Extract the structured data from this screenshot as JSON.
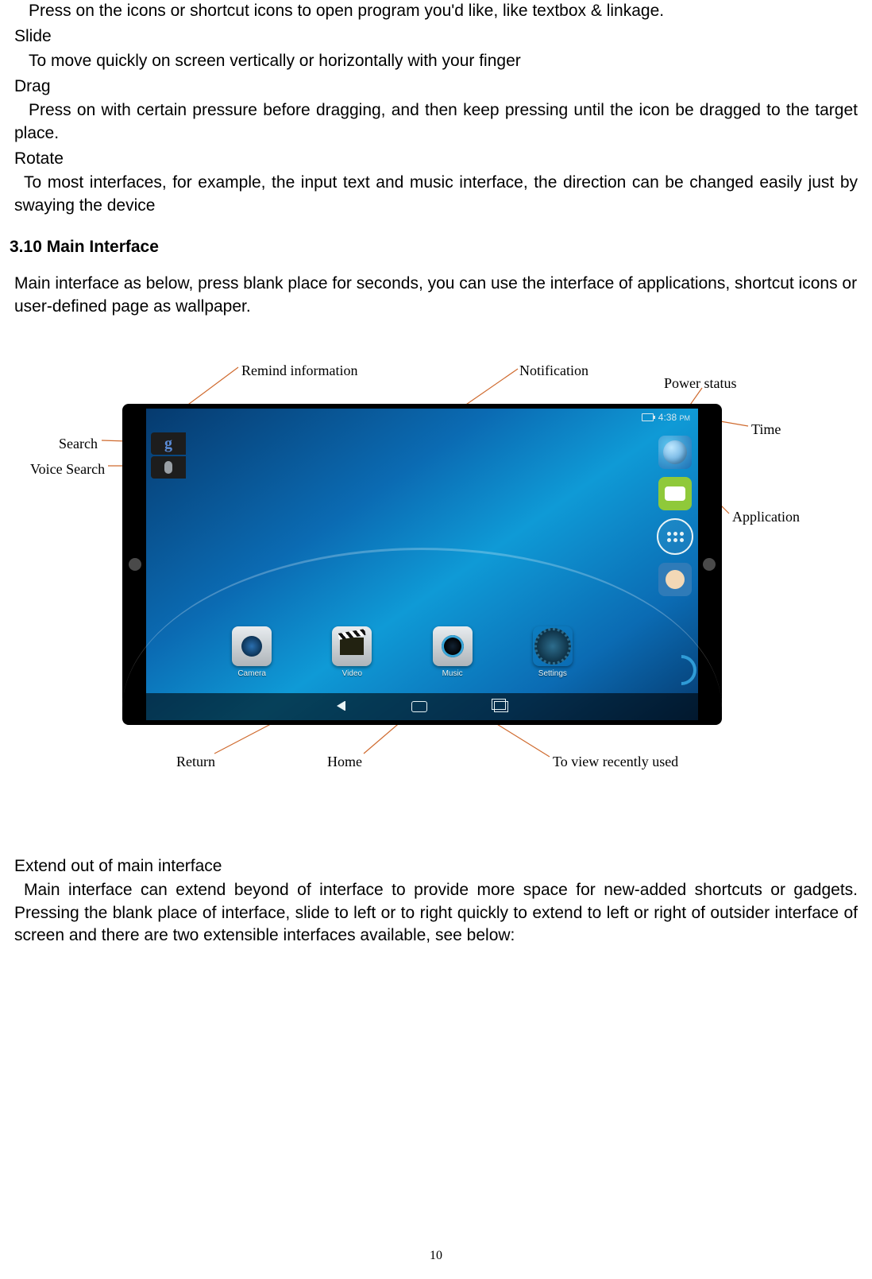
{
  "intro_text": "Press on the icons or shortcut icons to open program you'd like, like textbox & linkage.",
  "slide": {
    "heading": "Slide",
    "body": "To move quickly on screen vertically or horizontally with your finger"
  },
  "drag": {
    "heading": "Drag",
    "body": "Press on with certain pressure before dragging, and then keep pressing until the icon be dragged to the target place."
  },
  "rotate": {
    "heading": "Rotate",
    "body": "To most interfaces, for example, the input text and music interface,  the direction can be changed easily just by swaying the device"
  },
  "section_heading": "3.10 Main Interface",
  "section_body": "Main interface as below, press blank place for seconds, you can use the interface of applications, shortcut icons or user-defined page as wallpaper.",
  "figure": {
    "callouts": {
      "remind_information": "Remind information",
      "notification": "Notification",
      "power_status": "Power status",
      "time": "Time",
      "search": "Search",
      "voice_search": "Voice Search",
      "application": "Application",
      "return": "Return",
      "home": "Home",
      "recently_used": "To view recently used"
    },
    "status_time": "4:38",
    "status_time_suffix": "PM",
    "dock": {
      "camera": "Camera",
      "video": "Video",
      "music": "Music",
      "settings": "Settings"
    },
    "search_letter": "g"
  },
  "extend": {
    "heading": "Extend out of main interface",
    "body": "Main interface can extend beyond of interface to provide more space for new-added shortcuts or gadgets. Pressing the blank place of interface, slide to left or to right quickly to extend to left or right of outsider interface of screen and there are two extensible interfaces available, see below:"
  },
  "page_number": "10"
}
